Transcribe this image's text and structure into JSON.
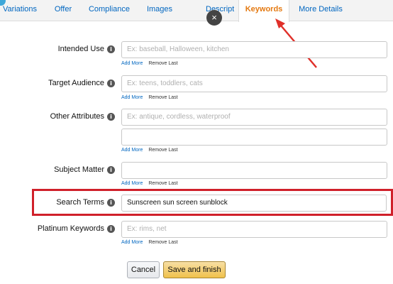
{
  "tabs": [
    {
      "label": "Variations",
      "active": false
    },
    {
      "label": "Offer",
      "active": false
    },
    {
      "label": "Compliance",
      "active": false
    },
    {
      "label": "Images",
      "active": false
    },
    {
      "label": "Description",
      "active": false
    },
    {
      "label": "Keywords",
      "active": true
    },
    {
      "label": "More Details",
      "active": false
    }
  ],
  "close_icon": "×",
  "info_icon": "i",
  "links": {
    "add": "Add More",
    "remove": "Remove Last"
  },
  "fields": {
    "intended_use": {
      "label": "Intended Use",
      "placeholder": "Ex: baseball, Halloween, kitchen",
      "value": ""
    },
    "target_audience": {
      "label": "Target Audience",
      "placeholder": "Ex: teens, toddlers, cats",
      "value": ""
    },
    "other_attributes": {
      "label": "Other Attributes",
      "placeholder": "Ex: antique, cordless, waterproof",
      "value": "",
      "extra_value": ""
    },
    "subject_matter": {
      "label": "Subject Matter",
      "placeholder": "",
      "value": ""
    },
    "search_terms": {
      "label": "Search Terms",
      "placeholder": "",
      "value": "Sunscreen sun screen sunblock"
    },
    "platinum_keywords": {
      "label": "Platinum Keywords",
      "placeholder": "Ex: rims, net",
      "value": ""
    }
  },
  "buttons": {
    "cancel": "Cancel",
    "save": "Save and finish"
  },
  "colors": {
    "active_tab": "#e47911",
    "link": "#0066c0",
    "annotation": "#d0202a",
    "save_button": "#f0c14b"
  }
}
